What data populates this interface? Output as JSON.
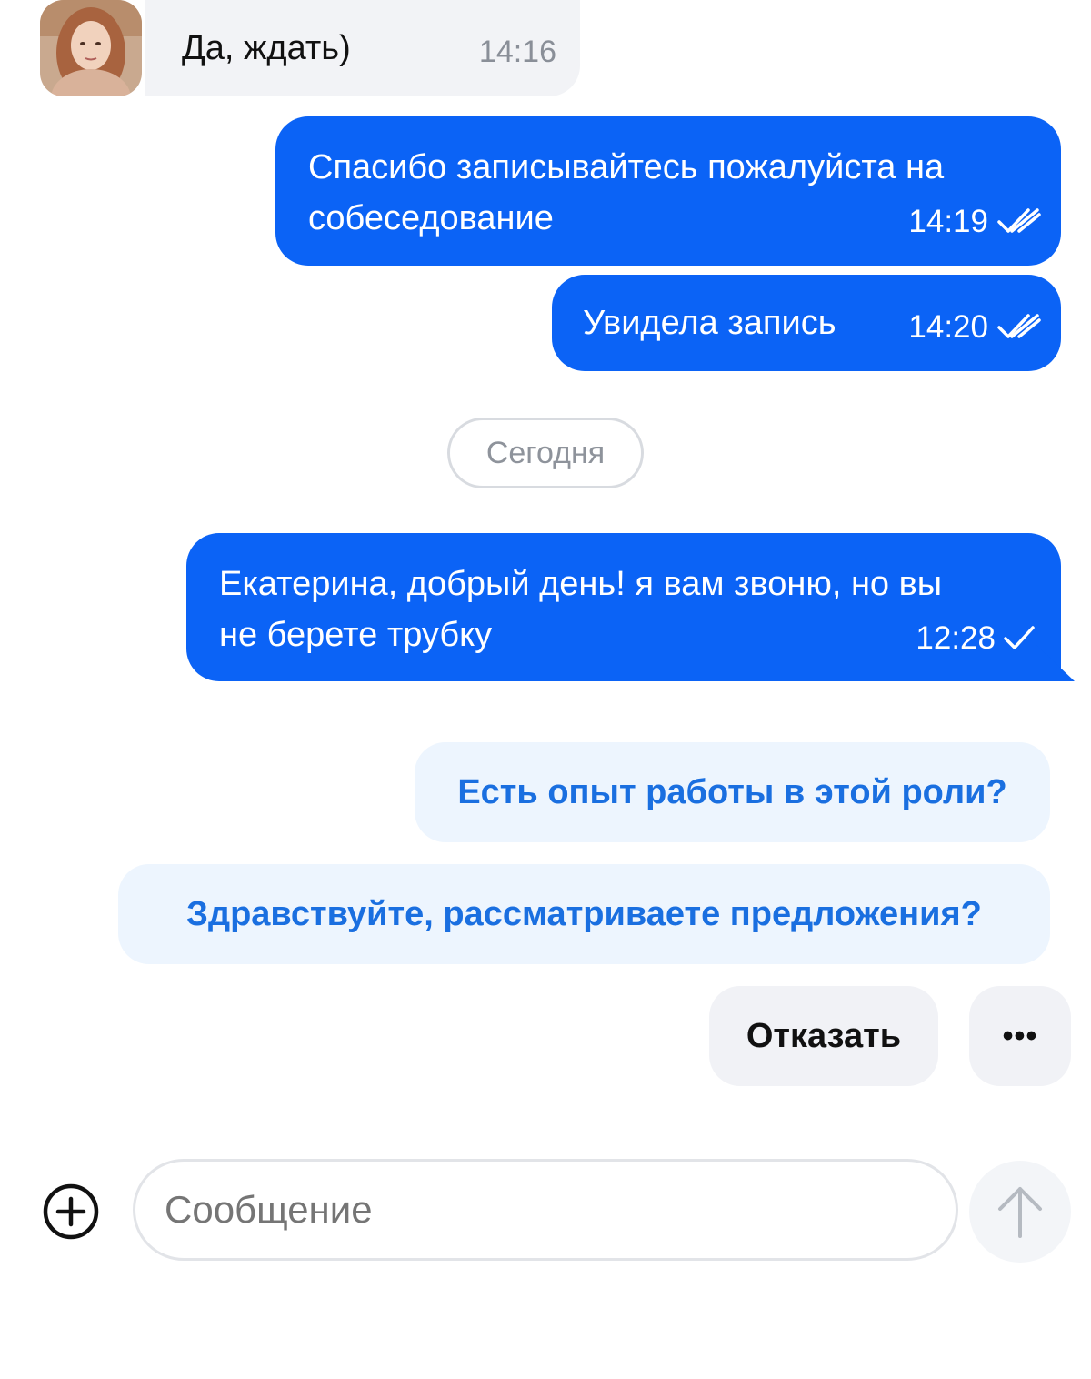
{
  "messages": {
    "incoming": {
      "text": "Да, ждать)",
      "time": "14:16"
    },
    "outgoing": [
      {
        "lines": [
          "Спасибо записывайтесь пожалуйста на",
          "собеседование"
        ],
        "time": "14:19",
        "status": "read"
      },
      {
        "lines": [
          "Увидела запись"
        ],
        "time": "14:20",
        "status": "read"
      },
      {
        "lines": [
          "Екатерина, добрый день! я вам звоню, но вы",
          "не берете трубку"
        ],
        "time": "12:28",
        "status": "sent"
      }
    ],
    "date_divider": "Сегодня"
  },
  "quick_replies": [
    "Есть опыт работы в этой роли?",
    "Здравствуйте, рассматриваете предложения?"
  ],
  "actions": {
    "decline_label": "Отказать",
    "more_label": "•••"
  },
  "composer": {
    "placeholder": "Сообщение"
  },
  "colors": {
    "outgoing_bubble": "#0b63f6",
    "suggestion_text": "#1a6fe0",
    "suggestion_bg": "#edf5fe"
  }
}
